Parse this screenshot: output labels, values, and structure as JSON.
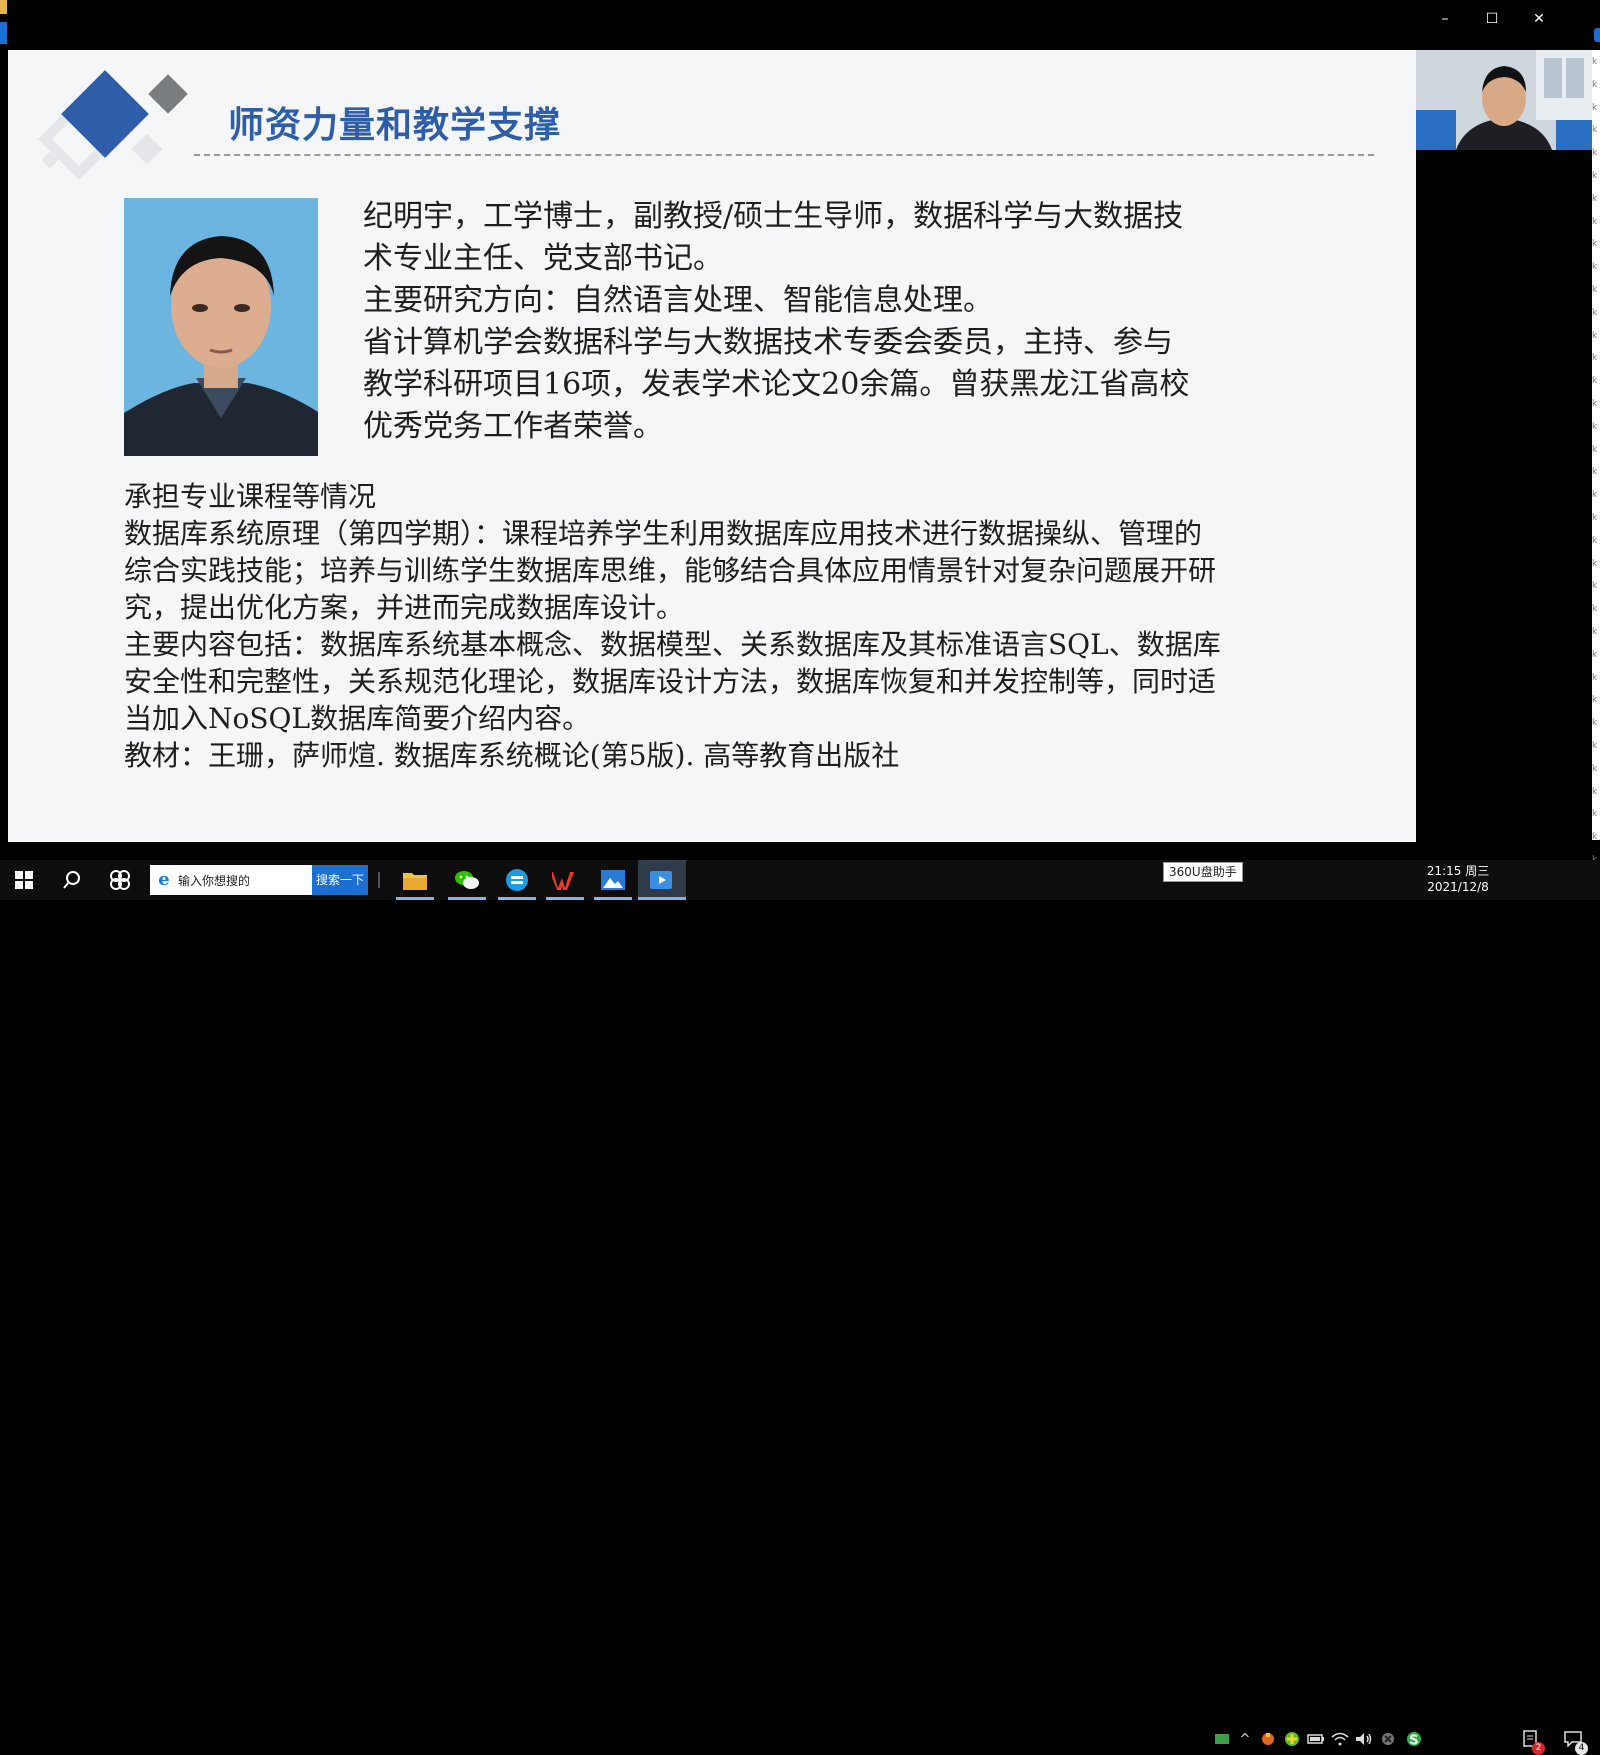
{
  "window": {
    "minimize_glyph": "–",
    "maximize_glyph": "☐",
    "close_glyph": "✕"
  },
  "slide": {
    "title": "师资力量和教学支撑",
    "bio": [
      "纪明宇，工学博士，副教授/硕士生导师，数据科学与大数据技",
      "术专业主任、党支部书记。",
      "主要研究方向：自然语言处理、智能信息处理。",
      "省计算机学会数据科学与大数据技术专委会委员，主持、参与",
      "教学科研项目16项，发表学术论文20余篇。曾获黑龙江省高校",
      "优秀党务工作者荣誉。"
    ],
    "course": [
      "承担专业课程等情况",
      "数据库系统原理（第四学期）：课程培养学生利用数据库应用技术进行数据操纵、管理的",
      "综合实践技能；培养与训练学生数据库思维，能够结合具体应用情景针对复杂问题展开研",
      "究，提出优化方案，并进而完成数据库设计。",
      "主要内容包括：数据库系统基本概念、数据模型、关系数据库及其标准语言SQL、数据库",
      "安全性和完整性，关系规范化理论，数据库设计方法，数据库恢复和并发控制等，同时适",
      "当加入NoSQL数据库简要介绍内容。",
      "教材：王珊，萨师煊. 数据库系统概论(第5版). 高等教育出版社"
    ]
  },
  "taskbar": {
    "search_placeholder": "输入你想搜的",
    "search_button": "搜索一下",
    "tooltip": "360U盘助手",
    "clock_time": "21:15 周三",
    "clock_date": "2021/12/8",
    "notification_badge": "2",
    "action_center_badge": "4",
    "tray_chevron": "^"
  },
  "colors": {
    "title_blue": "#2f5ea8",
    "accent_blue": "#1a6fd0",
    "slide_bg": "#f5f6f7"
  }
}
